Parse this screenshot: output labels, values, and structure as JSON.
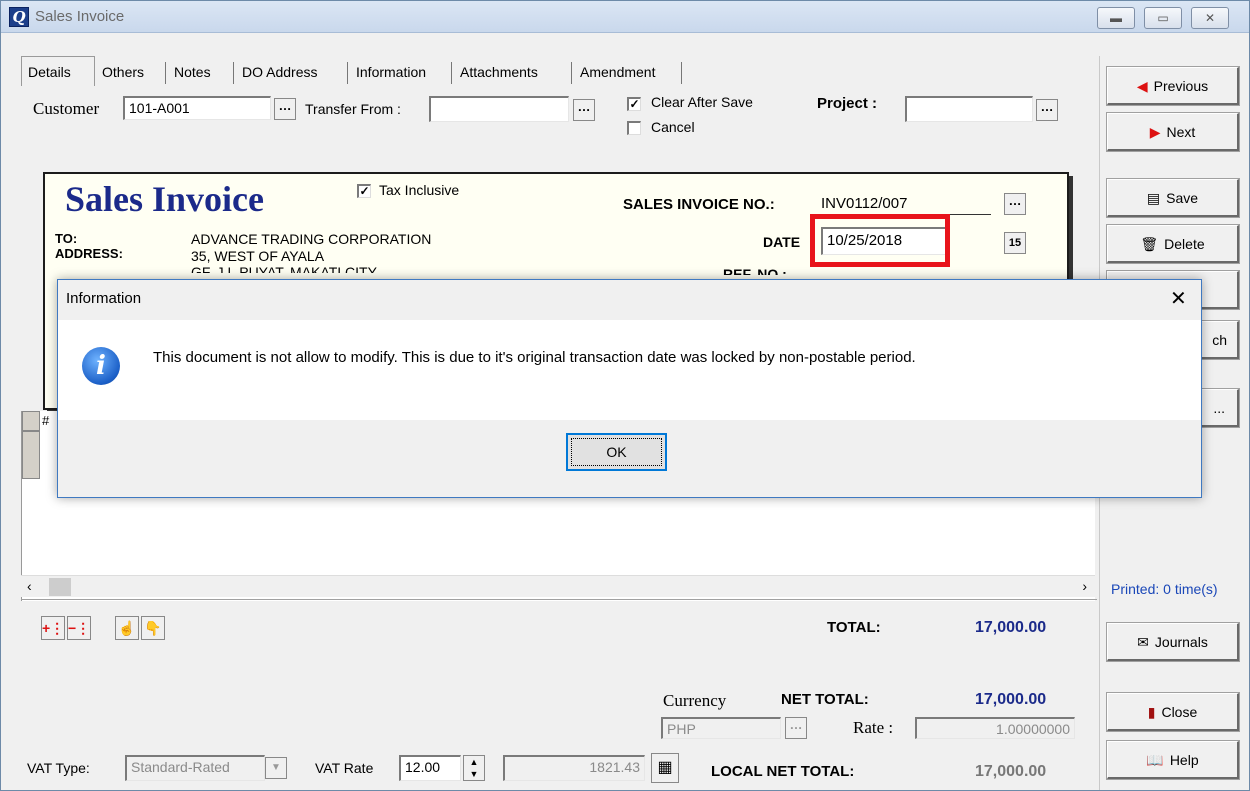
{
  "window": {
    "title": "Sales Invoice"
  },
  "tabs": [
    "Details",
    "Others",
    "Notes",
    "DO Address",
    "Information",
    "Attachments",
    "Amendment"
  ],
  "header": {
    "customer_label": "Customer",
    "customer_value": "101-A001",
    "transfer_label": "Transfer From :",
    "transfer_value": "",
    "clear_after_save_label": "Clear After Save",
    "clear_after_save_checked": true,
    "cancel_label": "Cancel",
    "cancel_checked": false,
    "project_label": "Project :",
    "project_value": ""
  },
  "doc": {
    "title": "Sales Invoice",
    "tax_inclusive_label": "Tax Inclusive",
    "tax_inclusive_checked": true,
    "invoice_no_label": "SALES INVOICE NO.:",
    "invoice_no_value": "INV0112/007",
    "date_label": "DATE",
    "date_value": "10/25/2018",
    "to_label": "TO:",
    "to_value": "ADVANCE TRADING CORPORATION",
    "address_label": "ADDRESS:",
    "address_line1": "35, WEST OF AYALA",
    "address_line2": "GF, J.L.PUYAT, MAKATI CITY",
    "ref_label": "REF. NO.:",
    "highlight_color": "#e8141b"
  },
  "right_panel": {
    "previous": "Previous",
    "next": "Next",
    "save": "Save",
    "delete": "Delete",
    "search_partial": "ch",
    "more_partial": "...",
    "printed": "Printed: 0 time(s)",
    "journals": "Journals",
    "close": "Close",
    "help": "Help"
  },
  "totals": {
    "total_label": "TOTAL:",
    "total_value": "17,000.00",
    "currency_label": "Currency",
    "currency_value": "PHP",
    "net_total_label": "NET TOTAL:",
    "net_total_value": "17,000.00",
    "rate_label": "Rate :",
    "rate_value": "1.00000000",
    "local_net_label": "LOCAL NET TOTAL:",
    "local_net_value": "17,000.00"
  },
  "vat": {
    "type_label": "VAT Type:",
    "type_value": "Standard-Rated",
    "rate_label": "VAT Rate",
    "rate_value": "12.00",
    "amount_value": "1821.43"
  },
  "grid": {
    "header_partial": "#"
  },
  "dialog": {
    "title": "Information",
    "message": "This document is not allow to modify. This is due to it's original transaction date was locked by non-postable period.",
    "ok": "OK",
    "close_glyph": "✕"
  }
}
